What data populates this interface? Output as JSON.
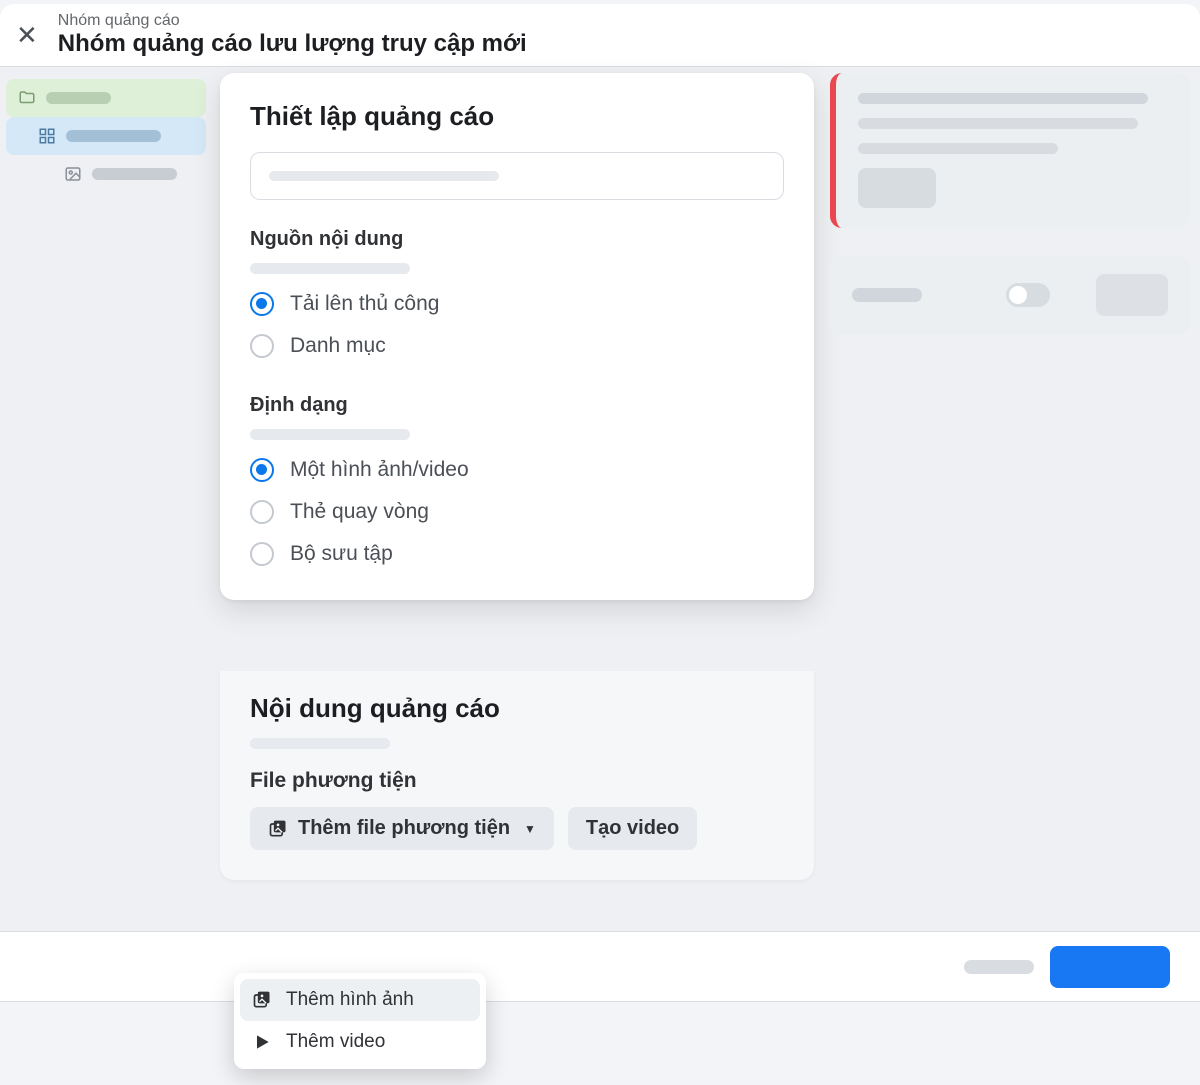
{
  "header": {
    "breadcrumb": "Nhóm quảng cáo",
    "title": "Nhóm quảng cáo lưu lượng truy cập mới"
  },
  "nav": {
    "items": [
      {
        "level": 1,
        "icon": "folder-icon"
      },
      {
        "level": 2,
        "icon": "grid-icon"
      },
      {
        "level": 3,
        "icon": "image-icon"
      }
    ]
  },
  "setup": {
    "title": "Thiết lập quảng cáo",
    "source_label": "Nguồn nội dung",
    "source_options": [
      {
        "label": "Tải lên thủ công",
        "checked": true
      },
      {
        "label": "Danh mục",
        "checked": false
      }
    ],
    "format_label": "Định dạng",
    "format_options": [
      {
        "label": "Một hình ảnh/video",
        "checked": true
      },
      {
        "label": "Thẻ quay vòng",
        "checked": false
      },
      {
        "label": "Bộ sưu tập",
        "checked": false
      }
    ]
  },
  "content": {
    "title": "Nội dung quảng cáo",
    "media_label": "File phương tiện",
    "add_media_btn": "Thêm file phương tiện",
    "create_video_btn": "Tạo video",
    "dropdown": [
      {
        "icon": "image-icon",
        "label": "Thêm hình ảnh"
      },
      {
        "icon": "play-icon",
        "label": "Thêm video"
      }
    ]
  }
}
